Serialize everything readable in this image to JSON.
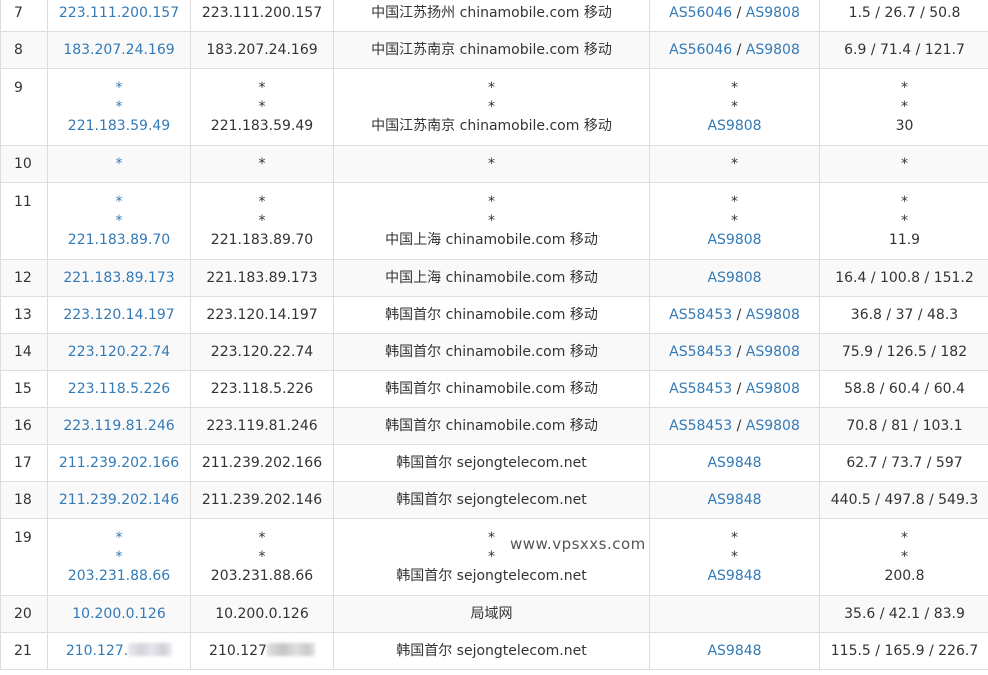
{
  "watermark": "www.vpsxxs.com",
  "rows": [
    {
      "hop": "7",
      "ip": [
        "223.111.200.157"
      ],
      "host": [
        "223.111.200.157"
      ],
      "loc": [
        "中国江苏扬州 chinamobile.com 移动"
      ],
      "asn": [
        [
          "AS56046",
          "AS9808"
        ]
      ],
      "rtt": [
        "1.5 / 26.7 / 50.8"
      ]
    },
    {
      "hop": "8",
      "ip": [
        "183.207.24.169"
      ],
      "host": [
        "183.207.24.169"
      ],
      "loc": [
        "中国江苏南京 chinamobile.com 移动"
      ],
      "asn": [
        [
          "AS56046",
          "AS9808"
        ]
      ],
      "rtt": [
        "6.9 / 71.4 / 121.7"
      ]
    },
    {
      "hop": "9",
      "ip": [
        "*",
        "*",
        "221.183.59.49"
      ],
      "host": [
        "*",
        "*",
        "221.183.59.49"
      ],
      "loc": [
        "*",
        "*",
        "中国江苏南京 chinamobile.com 移动"
      ],
      "asn": [
        [
          "*"
        ],
        [
          "*"
        ],
        [
          "AS9808"
        ]
      ],
      "rtt": [
        "*",
        "*",
        "30"
      ]
    },
    {
      "hop": "10",
      "ip": [
        "*"
      ],
      "host": [
        "*"
      ],
      "loc": [
        "*"
      ],
      "asn": [
        [
          "*"
        ]
      ],
      "rtt": [
        "*"
      ]
    },
    {
      "hop": "11",
      "ip": [
        "*",
        "*",
        "221.183.89.70"
      ],
      "host": [
        "*",
        "*",
        "221.183.89.70"
      ],
      "loc": [
        "*",
        "*",
        "中国上海 chinamobile.com 移动"
      ],
      "asn": [
        [
          "*"
        ],
        [
          "*"
        ],
        [
          "AS9808"
        ]
      ],
      "rtt": [
        "*",
        "*",
        "11.9"
      ]
    },
    {
      "hop": "12",
      "ip": [
        "221.183.89.173"
      ],
      "host": [
        "221.183.89.173"
      ],
      "loc": [
        "中国上海 chinamobile.com 移动"
      ],
      "asn": [
        [
          "AS9808"
        ]
      ],
      "rtt": [
        "16.4 / 100.8 / 151.2"
      ]
    },
    {
      "hop": "13",
      "ip": [
        "223.120.14.197"
      ],
      "host": [
        "223.120.14.197"
      ],
      "loc": [
        "韩国首尔 chinamobile.com 移动"
      ],
      "asn": [
        [
          "AS58453",
          "AS9808"
        ]
      ],
      "rtt": [
        "36.8 / 37 / 48.3"
      ]
    },
    {
      "hop": "14",
      "ip": [
        "223.120.22.74"
      ],
      "host": [
        "223.120.22.74"
      ],
      "loc": [
        "韩国首尔 chinamobile.com 移动"
      ],
      "asn": [
        [
          "AS58453",
          "AS9808"
        ]
      ],
      "rtt": [
        "75.9 / 126.5 / 182"
      ]
    },
    {
      "hop": "15",
      "ip": [
        "223.118.5.226"
      ],
      "host": [
        "223.118.5.226"
      ],
      "loc": [
        "韩国首尔 chinamobile.com 移动"
      ],
      "asn": [
        [
          "AS58453",
          "AS9808"
        ]
      ],
      "rtt": [
        "58.8 / 60.4 / 60.4"
      ]
    },
    {
      "hop": "16",
      "ip": [
        "223.119.81.246"
      ],
      "host": [
        "223.119.81.246"
      ],
      "loc": [
        "韩国首尔 chinamobile.com 移动"
      ],
      "asn": [
        [
          "AS58453",
          "AS9808"
        ]
      ],
      "rtt": [
        "70.8 / 81 / 103.1"
      ]
    },
    {
      "hop": "17",
      "ip": [
        "211.239.202.166"
      ],
      "host": [
        "211.239.202.166"
      ],
      "loc": [
        "韩国首尔 sejongtelecom.net"
      ],
      "asn": [
        [
          "AS9848"
        ]
      ],
      "rtt": [
        "62.7 / 73.7 / 597"
      ]
    },
    {
      "hop": "18",
      "ip": [
        "211.239.202.146"
      ],
      "host": [
        "211.239.202.146"
      ],
      "loc": [
        "韩国首尔 sejongtelecom.net"
      ],
      "asn": [
        [
          "AS9848"
        ]
      ],
      "rtt": [
        "440.5 / 497.8 / 549.3"
      ]
    },
    {
      "hop": "19",
      "ip": [
        "*",
        "*",
        "203.231.88.66"
      ],
      "host": [
        "*",
        "*",
        "203.231.88.66"
      ],
      "loc": [
        "*",
        "*",
        "韩国首尔 sejongtelecom.net"
      ],
      "asn": [
        [
          "*"
        ],
        [
          "*"
        ],
        [
          "AS9848"
        ]
      ],
      "rtt": [
        "*",
        "*",
        "200.8"
      ]
    },
    {
      "hop": "20",
      "ip": [
        "10.200.0.126"
      ],
      "host": [
        "10.200.0.126"
      ],
      "loc": [
        "局域网"
      ],
      "asn": [
        []
      ],
      "rtt": [
        "35.6 / 42.1 / 83.9"
      ]
    },
    {
      "hop": "21",
      "ip": [
        "210.127."
      ],
      "host": [
        "210.127"
      ],
      "loc": [
        "韩国首尔 sejongtelecom.net"
      ],
      "asn": [
        [
          "AS9848"
        ]
      ],
      "rtt": [
        "115.5 / 165.9 / 226.7"
      ]
    }
  ],
  "colors": {
    "link": "#337ab7",
    "text": "#333333",
    "border": "#dddddd",
    "stripe": "#f9f9f9"
  }
}
